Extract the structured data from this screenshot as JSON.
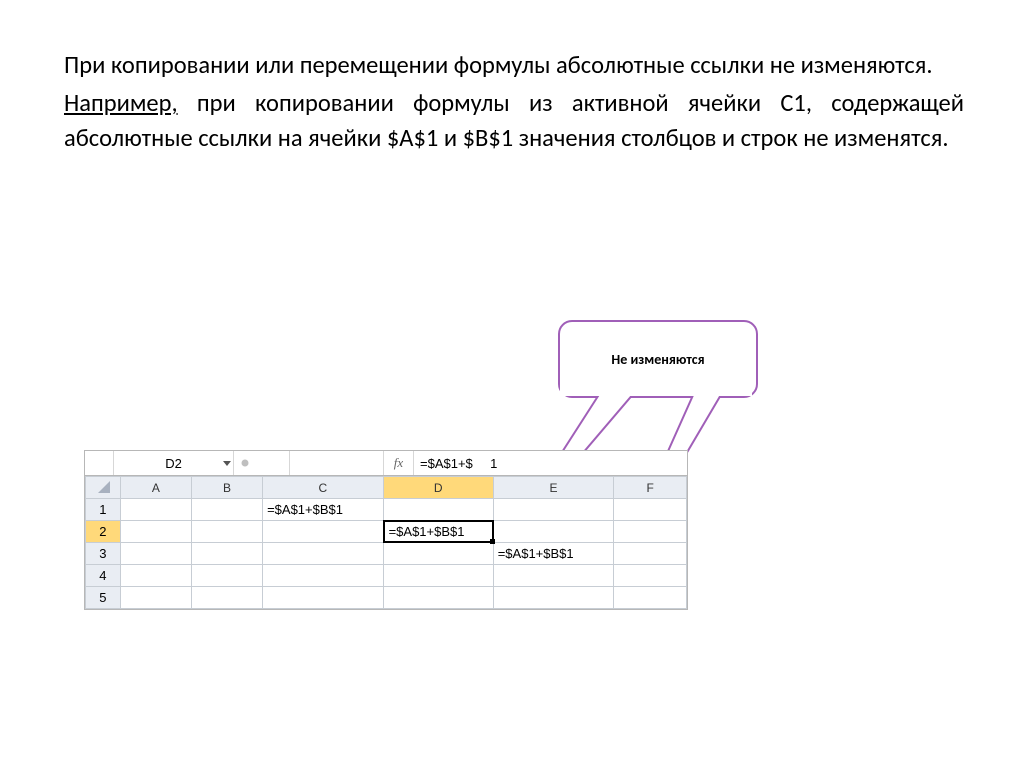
{
  "text": {
    "line1": "При копировании или перемещении формулы абсолютные ссылки не  изменяются.",
    "line2_prefix": " Например,",
    "line2_rest": " при  копировании формулы из активной ячейки С1, содержащей абсолютные ссылки на ячейки $А$1  и $В$1 значения столбцов и строк не изменятся."
  },
  "callout": {
    "label": "Не изменяются"
  },
  "spreadsheet": {
    "name_box": "D2",
    "fx_label": "fx",
    "formula_bar_partial_left": "=$A$1+$",
    "formula_bar_partial_right": "1",
    "columns": [
      "A",
      "B",
      "C",
      "D",
      "E",
      "F"
    ],
    "rows_shown": 5,
    "active_column": "D",
    "active_row": 2,
    "cells": {
      "C1": "=$A$1+$B$1",
      "D2": "=$A$1+$B$1",
      "E3": "=$A$1+$B$1"
    }
  }
}
